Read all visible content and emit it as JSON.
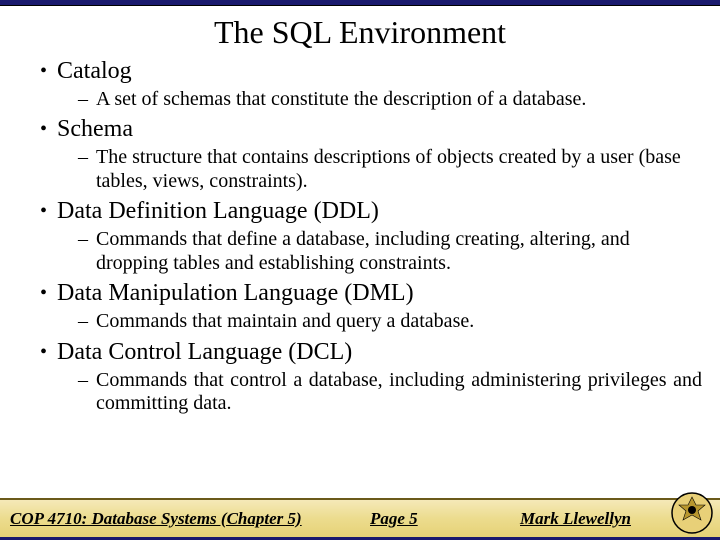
{
  "title": "The SQL Environment",
  "items": [
    {
      "heading": "Catalog",
      "sub": "A set of schemas that constitute the description of a database."
    },
    {
      "heading": "Schema",
      "sub": "The structure that contains descriptions of objects created by a user (base tables, views, constraints)."
    },
    {
      "heading": "Data Definition Language (DDL)",
      "sub": "Commands that define a database, including creating, altering, and dropping tables and establishing constraints."
    },
    {
      "heading": "Data Manipulation Language (DML)",
      "sub": "Commands that maintain and query a database."
    },
    {
      "heading": "Data Control Language (DCL)",
      "sub": "Commands that control a database, including administering privileges and committing data."
    }
  ],
  "footer": {
    "course": "COP 4710: Database Systems (Chapter 5)",
    "page": "Page 5",
    "author": "Mark Llewellyn"
  }
}
